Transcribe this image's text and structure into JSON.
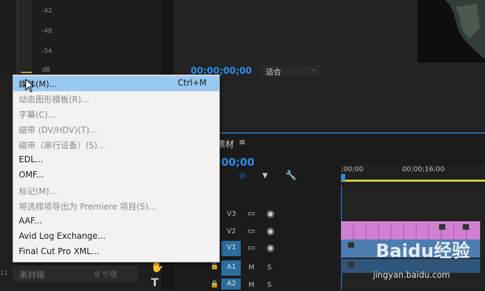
{
  "meter": {
    "db_labels": [
      "-42",
      "-48",
      "-54",
      "dB"
    ]
  },
  "monitor": {
    "timecode": "00;00;00;00",
    "fit": "适合"
  },
  "timeline": {
    "tab_label": "素材",
    "timecode": ";00;00",
    "ruler_labels": [
      ";00;00",
      "00;00;16;00"
    ],
    "tracks": {
      "v3": "V3",
      "v2": "V2",
      "v1": "V1",
      "a1": "A1",
      "a2": "A2"
    },
    "mute": "M",
    "solo": "S"
  },
  "project": {
    "name": "素材箱",
    "count": "9 个项",
    "left_num": "11"
  },
  "menu": {
    "items": [
      {
        "label": "媒体(M)...",
        "shortcut": "Ctrl+M",
        "enabled": true,
        "highlighted": true
      },
      {
        "label": "动态图形模板(R)...",
        "shortcut": "",
        "enabled": false
      },
      {
        "label": "字幕(C)...",
        "shortcut": "",
        "enabled": false
      },
      {
        "label": "磁带 (DV/HDV)(T)...",
        "shortcut": "",
        "enabled": false
      },
      {
        "label": "磁带（串行设备）(S)...",
        "shortcut": "",
        "enabled": false
      },
      {
        "label": "EDL...",
        "shortcut": "",
        "enabled": true
      },
      {
        "label": "OMF...",
        "shortcut": "",
        "enabled": true
      },
      {
        "label": "标记(M)...",
        "shortcut": "",
        "enabled": false
      },
      {
        "label": "将选择项导出为 Premiere 项目(S)...",
        "shortcut": "",
        "enabled": false
      },
      {
        "label": "AAF...",
        "shortcut": "",
        "enabled": true
      },
      {
        "label": "Avid Log Exchange...",
        "shortcut": "",
        "enabled": true
      },
      {
        "label": "Final Cut Pro XML...",
        "shortcut": "",
        "enabled": true
      }
    ]
  },
  "watermark": {
    "brand": "Baidu经验",
    "url": "jingyan.baidu.com"
  },
  "colors": {
    "accent": "#2d8ceb",
    "menu_highlight": "#99c8f0",
    "clip_pink": "#d17fd1",
    "clip_blue": "#4d7db0"
  }
}
